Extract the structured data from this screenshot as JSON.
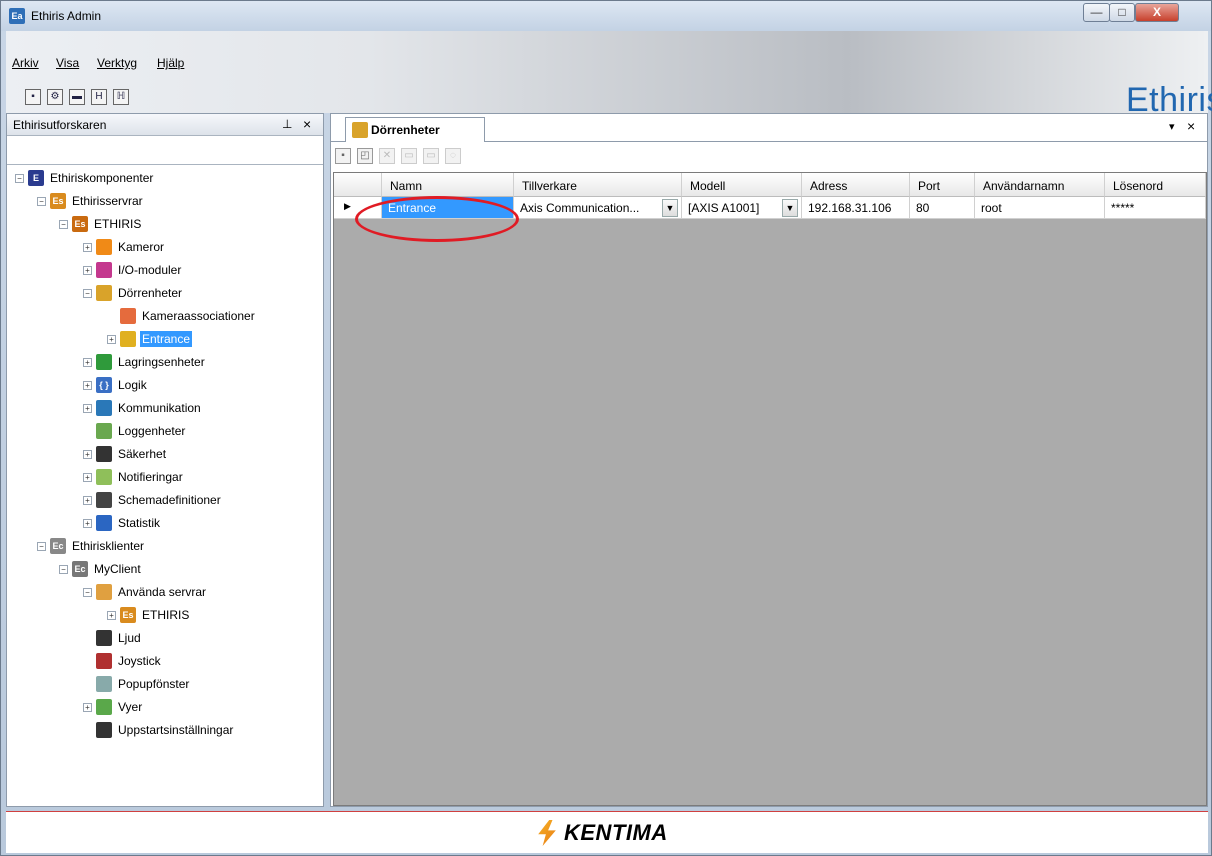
{
  "window": {
    "title": "Ethiris Admin",
    "app_icon": "Ea",
    "minimize": "—",
    "maximize": "□",
    "close": "X"
  },
  "menu": [
    "Arkiv",
    "Visa",
    "Verktyg",
    "Hjälp"
  ],
  "brand": {
    "logo_text": "Ethiris",
    "mark": "®"
  },
  "explorer": {
    "title": "Ethirisutforskaren",
    "pin": "⊥",
    "close": "×",
    "nodes": [
      {
        "label": "Ethiriskomponenter",
        "icon": "E",
        "color": "#2a3b8f",
        "toggle": "−"
      },
      {
        "label": "Ethirisservrar",
        "icon": "Es",
        "color": "#d98b1e",
        "toggle": "−"
      },
      {
        "label": "ETHIRIS",
        "icon": "Es",
        "color": "#c96a10",
        "toggle": "−"
      },
      {
        "label": "Kameror",
        "icon": "",
        "color": "#f08a17",
        "toggle": "+"
      },
      {
        "label": "I/O-moduler",
        "icon": "",
        "color": "#c4388e",
        "toggle": "+"
      },
      {
        "label": "Dörrenheter",
        "icon": "",
        "color": "#d9a32a",
        "toggle": "−"
      },
      {
        "label": "Kameraassociationer",
        "icon": "",
        "color": "#e56b3d",
        "toggle": ""
      },
      {
        "label": "Entrance",
        "icon": "",
        "color": "#e0b020",
        "toggle": "+"
      },
      {
        "label": "Lagringsenheter",
        "icon": "",
        "color": "#2f9a3b",
        "toggle": "+"
      },
      {
        "label": "Logik",
        "icon": "{ }",
        "color": "#3a6fc4",
        "toggle": "+"
      },
      {
        "label": "Kommunikation",
        "icon": "",
        "color": "#2a78b8",
        "toggle": "+"
      },
      {
        "label": "Loggenheter",
        "icon": "",
        "color": "#6aa84f",
        "toggle": ""
      },
      {
        "label": "Säkerhet",
        "icon": "",
        "color": "#333333",
        "toggle": "+"
      },
      {
        "label": "Notifieringar",
        "icon": "",
        "color": "#8fbf5a",
        "toggle": "+"
      },
      {
        "label": "Schemadefinitioner",
        "icon": "",
        "color": "#444444",
        "toggle": "+"
      },
      {
        "label": "Statistik",
        "icon": "",
        "color": "#2b66c2",
        "toggle": "+"
      },
      {
        "label": "Ethirisklienter",
        "icon": "Ec",
        "color": "#888888",
        "toggle": "−"
      },
      {
        "label": "MyClient",
        "icon": "Ec",
        "color": "#777777",
        "toggle": "−"
      },
      {
        "label": "Använda servrar",
        "icon": "",
        "color": "#e0a040",
        "toggle": "−"
      },
      {
        "label": "ETHIRIS",
        "icon": "Es",
        "color": "#d98b1e",
        "toggle": "+"
      },
      {
        "label": "Ljud",
        "icon": "",
        "color": "#333333",
        "toggle": ""
      },
      {
        "label": "Joystick",
        "icon": "",
        "color": "#b03030",
        "toggle": ""
      },
      {
        "label": "Popupfönster",
        "icon": "",
        "color": "#8aa",
        "toggle": ""
      },
      {
        "label": "Vyer",
        "icon": "",
        "color": "#5aa84a",
        "toggle": "+"
      },
      {
        "label": "Uppstartsinställningar",
        "icon": "",
        "color": "#333333",
        "toggle": ""
      }
    ]
  },
  "tab": {
    "label": "Dörrenheter",
    "menu": "▾",
    "close": "×"
  },
  "grid": {
    "columns": [
      "Namn",
      "Tillverkare",
      "Modell",
      "Adress",
      "Port",
      "Användarnamn",
      "Lösenord"
    ],
    "rows": [
      {
        "indicator": "▶",
        "namn": "Entrance",
        "tillverkare": "Axis Communication...",
        "modell": "[AXIS A1001]",
        "adress": "192.168.31.106",
        "port": "80",
        "anvandarnamn": "root",
        "losenord": "*****"
      }
    ],
    "combo_arrow": "▼"
  },
  "footer": {
    "logo_text": "KENTIMA"
  }
}
